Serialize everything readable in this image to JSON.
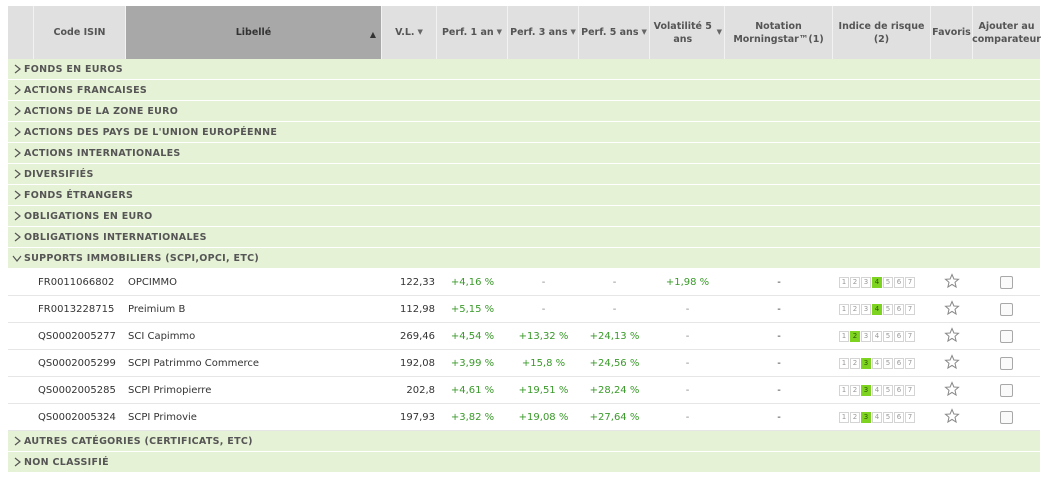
{
  "headers": {
    "isin": "Code ISIN",
    "libelle": "Libellé",
    "vl": "V.L.",
    "perf1": "Perf. 1 an",
    "perf3": "Perf. 3 ans",
    "perf5": "Perf. 5 ans",
    "volatility": "Volatilité 5 ans",
    "rating": "Notation Morningstar™(1)",
    "risk": "Indice de risque (2)",
    "favorites": "Favoris",
    "compare": "Ajouter au comparateur"
  },
  "categories_before": [
    "FONDS EN EUROS",
    "ACTIONS FRANCAISES",
    "ACTIONS DE LA ZONE EURO",
    "ACTIONS DES PAYS DE L'UNION EUROPÉENNE",
    "ACTIONS INTERNATIONALES",
    "DIVERSIFIÉS",
    "FONDS ÉTRANGERS",
    "OBLIGATIONS EN EURO",
    "OBLIGATIONS INTERNATIONALES"
  ],
  "expanded_category": "SUPPORTS IMMOBILIERS (SCPI,OPCI, ETC)",
  "funds": [
    {
      "isin": "FR0011066802",
      "name": "OPCIMMO",
      "vl": "122,33",
      "perf1": "+4,16 %",
      "perf3": "-",
      "perf5": "-",
      "vol": "+1,98 %",
      "rating": "-",
      "risk": 4
    },
    {
      "isin": "FR0013228715",
      "name": "Preimium B",
      "vl": "112,98",
      "perf1": "+5,15 %",
      "perf3": "-",
      "perf5": "-",
      "vol": "-",
      "rating": "-",
      "risk": 4
    },
    {
      "isin": "QS0002005277",
      "name": "SCI Capimmo",
      "vl": "269,46",
      "perf1": "+4,54 %",
      "perf3": "+13,32 %",
      "perf5": "+24,13 %",
      "vol": "-",
      "rating": "-",
      "risk": 2
    },
    {
      "isin": "QS0002005299",
      "name": "SCPI Patrimmo Commerce",
      "vl": "192,08",
      "perf1": "+3,99 %",
      "perf3": "+15,8 %",
      "perf5": "+24,56 %",
      "vol": "-",
      "rating": "-",
      "risk": 3
    },
    {
      "isin": "QS0002005285",
      "name": "SCPI Primopierre",
      "vl": "202,8",
      "perf1": "+4,61 %",
      "perf3": "+19,51 %",
      "perf5": "+28,24 %",
      "vol": "-",
      "rating": "-",
      "risk": 3
    },
    {
      "isin": "QS0002005324",
      "name": "SCPI Primovie",
      "vl": "197,93",
      "perf1": "+3,82 %",
      "perf3": "+19,08 %",
      "perf5": "+27,64 %",
      "vol": "-",
      "rating": "-",
      "risk": 3
    }
  ],
  "categories_after": [
    "AUTRES CATÉGORIES (CERTIFICATS, ETC)",
    "NON CLASSIFIÉ"
  ],
  "risk_scale": [
    "1",
    "2",
    "3",
    "4",
    "5",
    "6",
    "7"
  ],
  "colors": {
    "positive": "#3a9a2a",
    "category_bg": "#e6f2d6",
    "risk_active": "#7ed321",
    "header_bg": "#e0e0e0"
  }
}
